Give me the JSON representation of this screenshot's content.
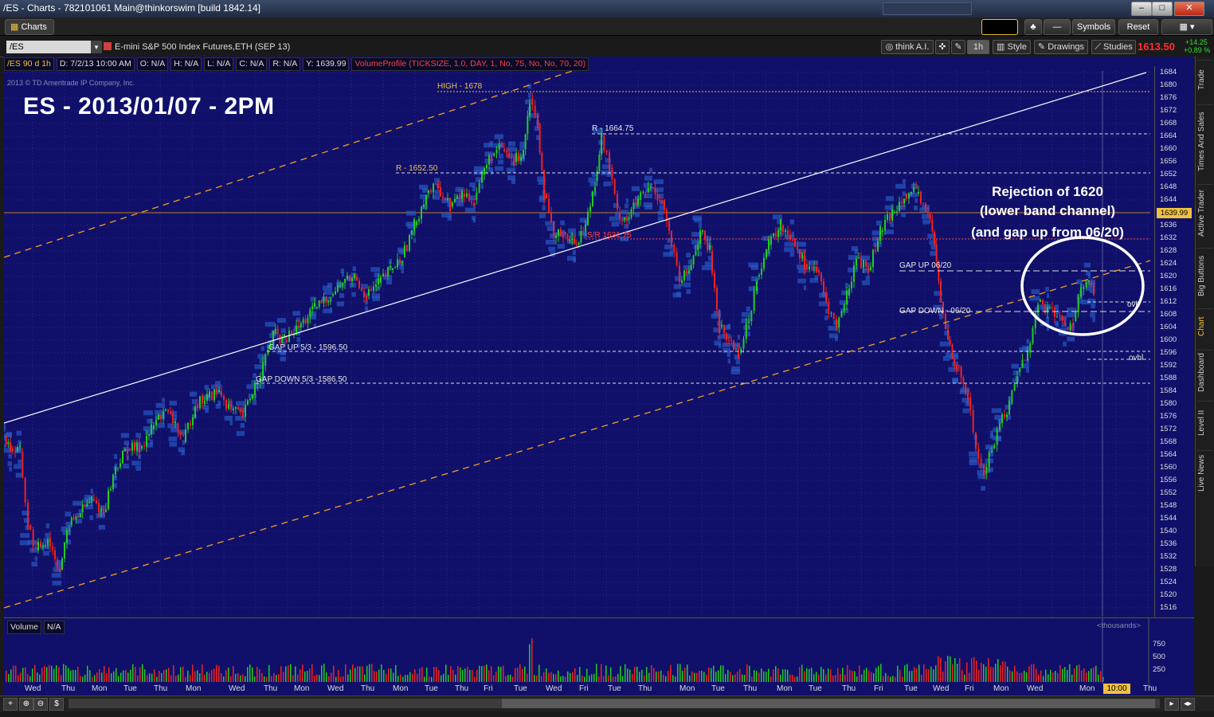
{
  "window": {
    "title": "/ES - Charts - 782101061 Main@thinkorswim [build 1842.14]"
  },
  "toolbar": {
    "tab": "Charts",
    "symbols": "Symbols",
    "reset": "Reset"
  },
  "symbol_row": {
    "symbol": "/ES",
    "description": "E-mini S&P 500 Index Futures,ETH (SEP 13)",
    "think_ai": "think A.I.",
    "timeframe": "1h",
    "style": "Style",
    "drawings": "Drawings",
    "studies": "Studies",
    "last_price": "1613.50",
    "change": "+14.25",
    "change_pct": "+0.89 %"
  },
  "infobar": {
    "symbol_agg": "/ES 90 d 1h",
    "date": "D: 7/2/13 10:00 AM",
    "open": "O: N/A",
    "high": "H: N/A",
    "low": "L: N/A",
    "close": "C: N/A",
    "range": "R: N/A",
    "y": "Y: 1639.99",
    "study": "VolumeProfile (TICKSIZE, 1.0, DAY, 1, No, 75, No, No, 70, 20)"
  },
  "chart": {
    "copyright": "2013 © TD Ameritrade IP Company, Inc.",
    "title": "ES - 2013/01/07 - 2PM",
    "note_lines": [
      "Rejection of 1620",
      "(lower band channel)",
      "(and gap up from 06/20)"
    ],
    "annotations": {
      "high": "HIGH - 1678",
      "r1": "R - 1664.75",
      "r2": "R - 1652.50",
      "sr": "S/R 1631.75",
      "gap_up_620": "GAP UP 06/20",
      "gap_down_620": "GAP DOWN - 06/20",
      "gap_up_53": "GAP UP 5/3 - 1596.50",
      "gap_down_53": "GAP DOWN 5/3 -1586.50",
      "ovh": "ovh",
      "ovhl": "ovhl"
    },
    "current_price_tag": "1639.99",
    "price_ticks": [
      "1684",
      "1680",
      "1676",
      "1672",
      "1668",
      "1664",
      "1660",
      "1656",
      "1652",
      "1648",
      "1644",
      "1640",
      "1636",
      "1632",
      "1628",
      "1624",
      "1620",
      "1616",
      "1612",
      "1608",
      "1604",
      "1600",
      "1596",
      "1592",
      "1588",
      "1584",
      "1580",
      "1576",
      "1572",
      "1568",
      "1564",
      "1560",
      "1556",
      "1552",
      "1548",
      "1544",
      "1540",
      "1536",
      "1532",
      "1528",
      "1524",
      "1520",
      "1516"
    ],
    "colors": {
      "background": "#10106a",
      "up": "#22cc22",
      "down": "#ee2222",
      "profile": "#2a5cc8",
      "channel": "#f0a020",
      "trend": "#ffffff"
    }
  },
  "volume": {
    "label": "Volume",
    "value": "N/A",
    "units": "<thousands>",
    "ticks": [
      "750",
      "500",
      "250"
    ]
  },
  "date_axis": {
    "labels": [
      "Wed",
      "Thu",
      "Mon",
      "Tue",
      "Thu",
      "Mon",
      "Wed",
      "Thu",
      "Mon",
      "Wed",
      "Thu",
      "Mon",
      "Tue",
      "Thu",
      "Fri",
      "Tue",
      "Wed",
      "Fri",
      "Tue",
      "Thu",
      "Mon",
      "Tue",
      "Thu",
      "Mon",
      "Tue",
      "Thu",
      "Fri",
      "Tue",
      "Wed",
      "Fri",
      "Mon",
      "Wed",
      "Mon",
      "Thu"
    ],
    "time_box": "10:00"
  },
  "side_panel": [
    "Trade",
    "Times And Sales",
    "Active Trader",
    "Big Buttons",
    "Chart",
    "Dashboard",
    "Level II",
    "Live News"
  ]
}
